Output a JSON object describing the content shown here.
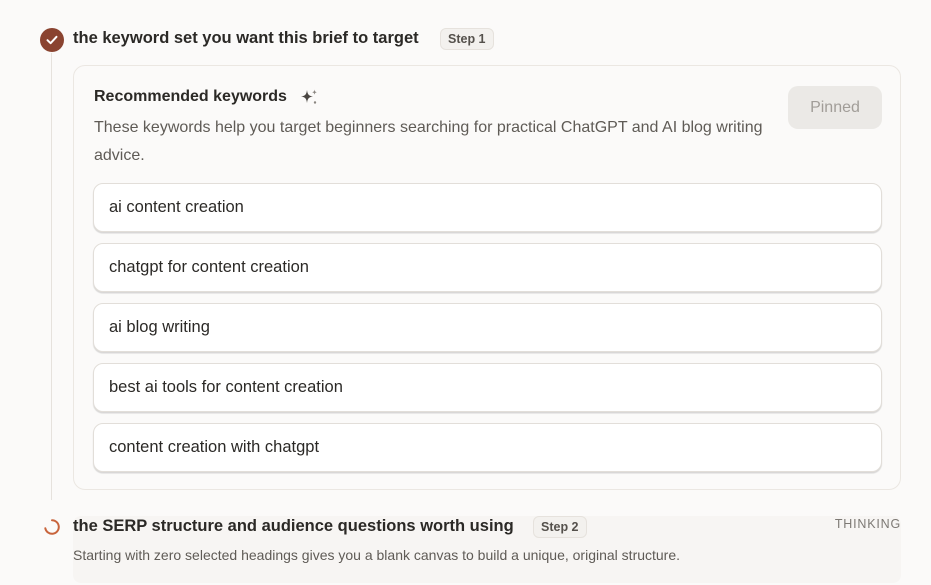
{
  "steps": [
    {
      "title": "the keyword set you want this brief to target",
      "badge": "Step 1",
      "status": "complete",
      "card": {
        "title": "Recommended keywords",
        "description": "These keywords help you target beginners searching for practical ChatGPT and AI blog writing advice.",
        "pinned_label": "Pinned",
        "keywords": [
          "ai content creation",
          "chatgpt for content creation",
          "ai blog writing",
          "best ai tools for content creation",
          "content creation with chatgpt"
        ]
      }
    },
    {
      "title": "the SERP structure and audience questions worth using",
      "badge": "Step 2",
      "status": "THINKING",
      "text": "Starting with zero selected headings gives you a blank canvas to build a unique, original structure."
    }
  ],
  "icons": {
    "step1": "check-icon",
    "step2": "spinner-icon",
    "card_title": "sparkle-icon"
  },
  "colors": {
    "accent": "#8a4330",
    "spinner": "#c8643c",
    "background": "#fbfaf9"
  }
}
